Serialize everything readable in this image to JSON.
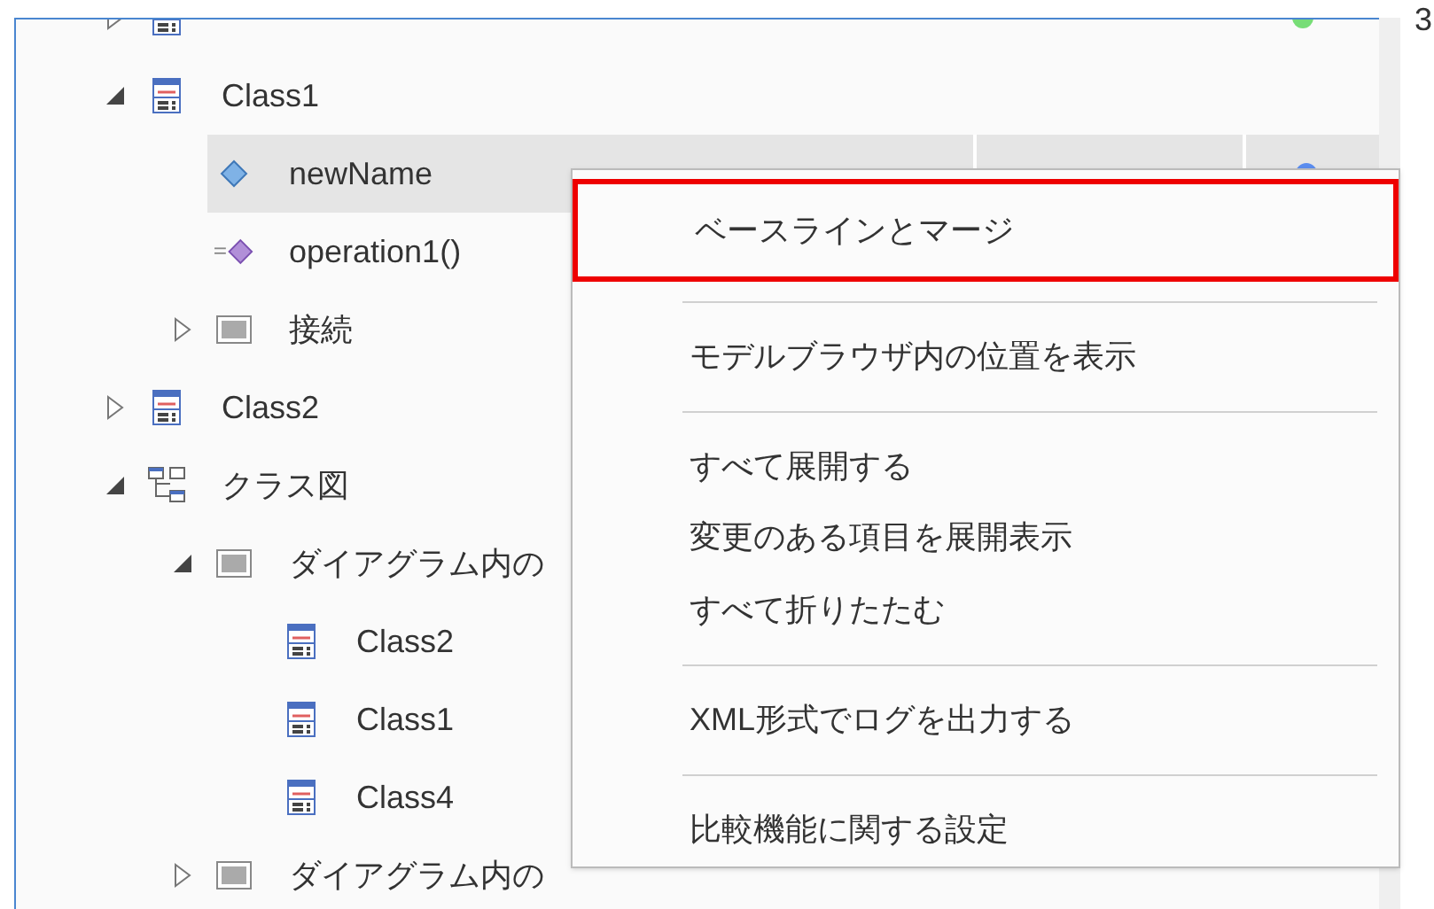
{
  "tree": [
    {
      "kind": "class",
      "expanded": false,
      "selected": false,
      "color": "#77dd77"
    },
    {
      "label": "Class1",
      "kind": "class",
      "expanded": true,
      "selected": false,
      "children": [
        {
          "label": "newName",
          "kind": "attribute",
          "selected": true,
          "color": "#5b8def"
        },
        {
          "label": "operation1()",
          "kind": "operation",
          "selected": false
        },
        {
          "label": "接続",
          "kind": "folder",
          "expanded": false,
          "selected": false
        }
      ]
    },
    {
      "label": "Class2",
      "kind": "class",
      "expanded": false,
      "selected": false
    },
    {
      "label": "クラス図",
      "kind": "diagram",
      "expanded": true,
      "selected": false,
      "children": [
        {
          "label": "ダイアグラム内の",
          "kind": "folder",
          "expanded": true,
          "selected": false,
          "children": [
            {
              "label": "Class2",
              "kind": "class",
              "selected": false
            },
            {
              "label": "Class1",
              "kind": "class",
              "selected": false
            },
            {
              "label": "Class4",
              "kind": "class",
              "selected": false
            }
          ]
        },
        {
          "label": "ダイアグラム内の",
          "kind": "folder",
          "expanded": false,
          "selected": false
        }
      ]
    }
  ],
  "side_text": "3",
  "menu": [
    {
      "kind": "item",
      "label": "ベースラインとマージ",
      "highlighted": true
    },
    {
      "kind": "separator"
    },
    {
      "kind": "item",
      "label": "モデルブラウザ内の位置を表示",
      "highlighted": false
    },
    {
      "kind": "separator"
    },
    {
      "kind": "item",
      "label": "すべて展開する",
      "highlighted": false
    },
    {
      "kind": "item",
      "label": "変更のある項目を展開表示",
      "highlighted": false
    },
    {
      "kind": "item",
      "label": "すべて折りたたむ",
      "highlighted": false
    },
    {
      "kind": "separator"
    },
    {
      "kind": "item",
      "label": "XML形式でログを出力する",
      "highlighted": false
    },
    {
      "kind": "separator"
    },
    {
      "kind": "item",
      "label": "比較機能に関する設定",
      "highlighted": false
    }
  ]
}
